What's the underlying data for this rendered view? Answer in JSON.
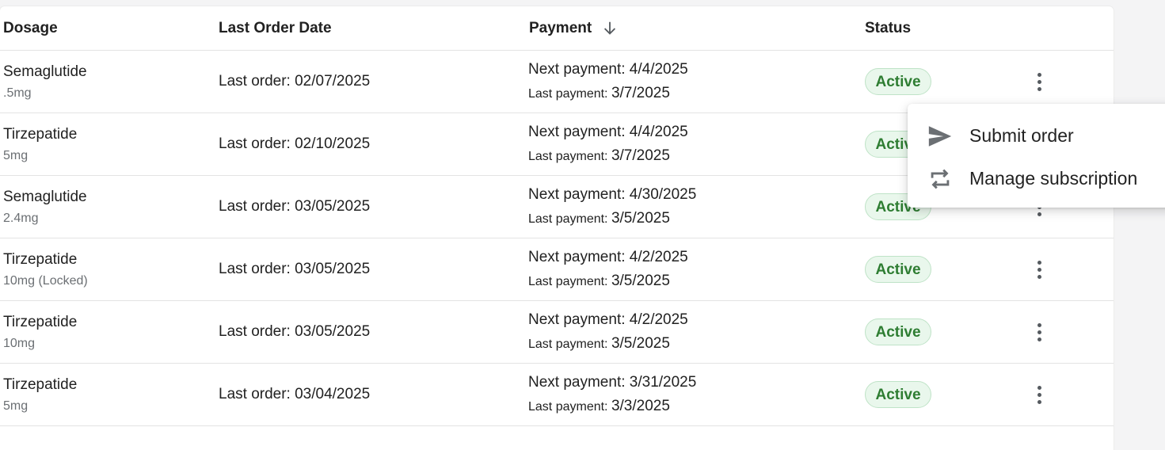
{
  "table": {
    "headers": {
      "dosage": "Dosage",
      "last_order_date": "Last Order Date",
      "payment": "Payment",
      "status": "Status"
    },
    "sort_icon": "arrow-down-icon",
    "rows": [
      {
        "name": "Semaglutide",
        "dose": ".5mg",
        "last_order": "Last order: 02/07/2025",
        "next_payment": "Next payment: 4/4/2025",
        "last_payment_label": "Last payment:",
        "last_payment_value": "3/7/2025",
        "status": "Active"
      },
      {
        "name": "Tirzepatide",
        "dose": "5mg",
        "last_order": "Last order: 02/10/2025",
        "next_payment": "Next payment: 4/4/2025",
        "last_payment_label": "Last payment:",
        "last_payment_value": "3/7/2025",
        "status": "Active"
      },
      {
        "name": "Semaglutide",
        "dose": "2.4mg",
        "last_order": "Last order: 03/05/2025",
        "next_payment": "Next payment: 4/30/2025",
        "last_payment_label": "Last payment:",
        "last_payment_value": "3/5/2025",
        "status": "Active"
      },
      {
        "name": "Tirzepatide",
        "dose": "10mg (Locked)",
        "last_order": "Last order: 03/05/2025",
        "next_payment": "Next payment: 4/2/2025",
        "last_payment_label": "Last payment:",
        "last_payment_value": "3/5/2025",
        "status": "Active"
      },
      {
        "name": "Tirzepatide",
        "dose": "10mg",
        "last_order": "Last order: 03/05/2025",
        "next_payment": "Next payment: 4/2/2025",
        "last_payment_label": "Last payment:",
        "last_payment_value": "3/5/2025",
        "status": "Active"
      },
      {
        "name": "Tirzepatide",
        "dose": "5mg",
        "last_order": "Last order: 03/04/2025",
        "next_payment": "Next payment: 3/31/2025",
        "last_payment_label": "Last payment:",
        "last_payment_value": "3/3/2025",
        "status": "Active"
      }
    ]
  },
  "menu": {
    "items": [
      {
        "label": "Submit order",
        "icon": "send-icon"
      },
      {
        "label": "Manage subscription",
        "icon": "repeat-icon"
      }
    ]
  },
  "colors": {
    "status_text": "#2e7d32",
    "status_bg": "#e9f7ec",
    "status_border": "#bfe3c7"
  }
}
